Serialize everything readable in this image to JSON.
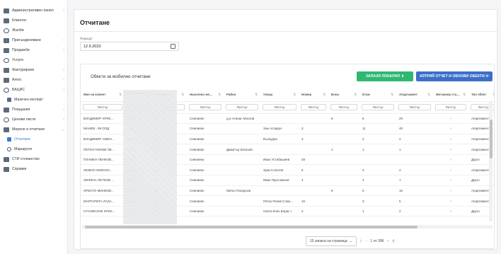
{
  "sidebar": {
    "items": [
      {
        "label": "Административен панел",
        "icon": "admin-panel-icon",
        "chevron": "‹"
      },
      {
        "label": "Клиенти",
        "icon": "users-icon",
        "chevron": ""
      },
      {
        "label": "Жалби",
        "icon": "complaint-icon",
        "chevron": ""
      },
      {
        "label": "Присъединяване",
        "icon": "user-plus-icon",
        "chevron": "‹"
      },
      {
        "label": "Продажби",
        "icon": "sales-icon",
        "chevron": "‹"
      },
      {
        "label": "Услуги",
        "icon": "services-icon",
        "chevron": ""
      },
      {
        "label": "Фактуриране",
        "icon": "invoice-icon",
        "chevron": "‹"
      },
      {
        "label": "Алгос",
        "icon": "algos-icon",
        "chevron": "‹"
      },
      {
        "label": "БАЦИС",
        "icon": "bacis-icon",
        "chevron": "‹"
      },
      {
        "label": "Мазечен експорт",
        "icon": "export-icon",
        "chevron": "",
        "sub": true
      },
      {
        "label": "Плащания",
        "icon": "payments-icon",
        "chevron": "‹"
      },
      {
        "label": "Ценови листи",
        "icon": "price-list-icon",
        "chevron": "‹"
      },
      {
        "label": "Мерене и отчитане",
        "icon": "meter-icon",
        "chevron": "⌄"
      },
      {
        "label": "Отчитане",
        "icon": "reading-icon",
        "chevron": "",
        "sub": true,
        "active": true
      },
      {
        "label": "Маршрути",
        "icon": "routes-icon",
        "chevron": "",
        "sub": true
      },
      {
        "label": "СТИ стопанство",
        "icon": "sti-icon",
        "chevron": ""
      },
      {
        "label": "Справки",
        "icon": "reports-icon",
        "chevron": ""
      }
    ]
  },
  "page": {
    "title": "Отчитане",
    "period_label": "Период",
    "period_required": "*",
    "period_value": "12.9.2023"
  },
  "panel": {
    "title": "Обекти за мобилно отчитане",
    "btn_save": "ЗАПАЗИ ЛОКАЛНО",
    "btn_save_icon": "⬇",
    "btn_clear": "ИЗТРИЙ ОТЧЕТ И ОБНОВИ ОБЕКТИ",
    "btn_clear_icon": "⟳"
  },
  "table": {
    "headers": [
      "Име на клиент",
      "Клиентски н…",
      "Разходомер",
      "Населено ме…",
      "Район",
      "Улица",
      "Номер",
      "Блок",
      "Етаж",
      "Апартамент",
      "Метанова ста…",
      "Тип обект"
    ],
    "filter_label": "Филтър",
    "rows": [
      [
        "ВЛАДИМИР ХРИС…",
        "540",
        "90",
        "Севлиево",
        "д-р Атанас Москов",
        "",
        "",
        "8",
        "8",
        "29",
        "×",
        "Апартамент"
      ],
      [
        "МАНЕВ - 09 ООД",
        "540",
        "56",
        "Севлиево",
        "",
        "Хан Аспарух",
        "3",
        "",
        "11",
        "40",
        "×",
        "Апартамент"
      ],
      [
        "ВЛАДИМИР СМЕН…",
        "540",
        "39",
        "Севлиево",
        "",
        "Възпудка",
        "3",
        "",
        "2",
        "4",
        "×",
        "Апартамент"
      ],
      [
        "ПЕТКО ПИЛОВ ПЕ…",
        "540",
        "46",
        "Севлиево",
        "Димитър Благоев",
        "",
        "",
        "1",
        "1",
        "1",
        "×",
        "Апартамент"
      ],
      [
        "ПЛАМЕН ПЕНКОВ…",
        "540",
        "31",
        "Севлиево",
        "",
        "Иван Устабашиев",
        "28",
        "",
        "",
        "",
        "×",
        "Друго"
      ],
      [
        "ЛЮБЧО НИКОЛО…",
        "540",
        "36",
        "Севлиево",
        "",
        "Христо Ботев",
        "5",
        "",
        "2",
        "4",
        "×",
        "Апартамент"
      ],
      [
        "ЛИЛЯНА ПЕТКОВ…",
        "540",
        "20",
        "Севлиево",
        "",
        "Иван Преславски",
        "4",
        "",
        "4",
        "7",
        "×",
        "Друго"
      ],
      [
        "ХРИСТО МИНКОВ…",
        "540",
        "59",
        "Севлиево",
        "Митко Палаузов",
        "",
        "",
        "9",
        "6",
        "15",
        "×",
        "Апартамент"
      ],
      [
        "МАРГАРИТА ЛАЗА…",
        "540",
        "57",
        "Севлиево",
        "",
        "Петко Рачев Слав…",
        "16",
        "",
        "3",
        "5",
        "×",
        "Апартамент"
      ],
      [
        "СТАНИСЛАВ ХРИС…",
        "540",
        "32",
        "Севлиево",
        "",
        "Свети Княз Борис I",
        "2",
        "",
        "1",
        "2",
        "×",
        "Друго"
      ]
    ]
  },
  "pager": {
    "page_size": "15 записа на страница",
    "range": "1 от 396"
  }
}
